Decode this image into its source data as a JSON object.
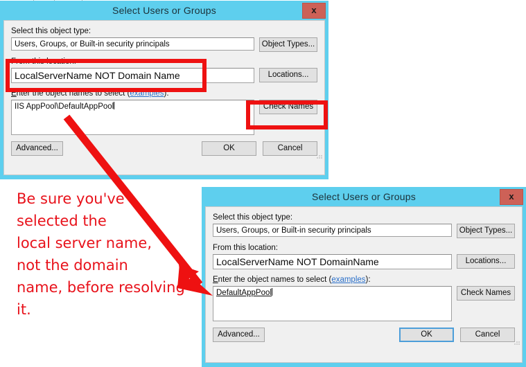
{
  "dialog1": {
    "title": "Select Users or Groups",
    "close_label": "x",
    "object_type_label": "Select this object type:",
    "object_type_value": "Users, Groups, or Built-in security principals",
    "object_types_button": "Object Types...",
    "location_label": "From this location:",
    "location_value": "LocalServerName NOT Domain Name",
    "locations_button": "Locations...",
    "names_label_prefix": "E",
    "names_label_mid": "nter the object names to select (",
    "names_label_link": "examples",
    "names_label_suffix": "):",
    "names_value": "IIS AppPool\\DefaultAppPool",
    "check_names_button": "Check Names",
    "advanced_button": "Advanced...",
    "ok_button": "OK",
    "cancel_button": "Cancel"
  },
  "dialog2": {
    "title": "Select Users or Groups",
    "close_label": "x",
    "object_type_label": "Select this object type:",
    "object_type_value": "Users, Groups, or Built-in security principals",
    "object_types_button": "Object Types...",
    "location_label": "From this location:",
    "location_value": "LocalServerName NOT DomainName",
    "locations_button": "Locations...",
    "names_label_prefix": "E",
    "names_label_mid": "nter the object names to select (",
    "names_label_link": "examples",
    "names_label_suffix": "):",
    "names_value": "DefaultAppPool",
    "check_names_button": "Check Names",
    "advanced_button": "Advanced...",
    "ok_button": "OK",
    "cancel_button": "Cancel"
  },
  "annotation": {
    "text": "Be sure you've\nselected the\nlocal server name,\nnot the domain\nname, before resolving\nit.",
    "color": "#e8121b"
  },
  "colors": {
    "titlebar": "#5ecfee",
    "close_button": "#cd6157",
    "dialog_face": "#f0f0f0",
    "highlight_red": "#ee1111",
    "link_blue": "#2a6fc9",
    "focus_blue": "#4c9ed9"
  }
}
